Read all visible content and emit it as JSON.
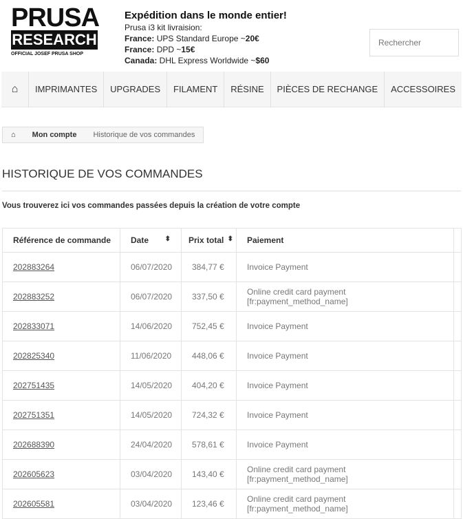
{
  "logo": {
    "line1": "PRUSA",
    "line2": "RESEARCH",
    "line3": "OFFICIAL JOSEF PRUSA SHOP"
  },
  "shipping": {
    "title": "Expédition dans le monde entier!",
    "subtitle": "Prusa i3 kit livraision:",
    "lines": [
      {
        "country": "France:",
        "carrier": " UPS Standard Europe ~",
        "price": "20€"
      },
      {
        "country": "France:",
        "carrier": " DPD ~",
        "price": "15€"
      },
      {
        "country": "Canada:",
        "carrier": " DHL Express Worldwide ~",
        "price": "$60"
      }
    ]
  },
  "search": {
    "placeholder": "Rechercher"
  },
  "nav": {
    "home_icon": "home-icon",
    "items": [
      "IMPRIMANTES",
      "UPGRADES",
      "FILAMENT",
      "RÉSINE",
      "PIÈCES DE RECHANGE",
      "ACCESSOIRES"
    ]
  },
  "breadcrumb": {
    "items": [
      "Mon compte",
      "Historique de vos commandes"
    ]
  },
  "page": {
    "title": "HISTORIQUE DE VOS COMMANDES",
    "intro": "Vous trouverez ici vos commandes passées depuis la création de votre compte"
  },
  "table": {
    "headers": [
      "Référence de commande",
      "Date",
      "Prix total",
      "Paiement"
    ],
    "rows": [
      [
        "202883264",
        "06/07/2020",
        "384,77 €",
        "Invoice Payment"
      ],
      [
        "202883252",
        "06/07/2020",
        "337,50 €",
        "Online credit card payment [fr:payment_method_name]"
      ],
      [
        "202833071",
        "14/06/2020",
        "752,45 €",
        "Invoice Payment"
      ],
      [
        "202825340",
        "11/06/2020",
        "448,06 €",
        "Invoice Payment"
      ],
      [
        "202751435",
        "14/05/2020",
        "404,20 €",
        "Invoice Payment"
      ],
      [
        "202751351",
        "14/05/2020",
        "724,32 €",
        "Invoice Payment"
      ],
      [
        "202688390",
        "24/04/2020",
        "578,61 €",
        "Invoice Payment"
      ],
      [
        "202605623",
        "03/04/2020",
        "143,40 €",
        "Online credit card payment [fr:payment_method_name]"
      ],
      [
        "202605581",
        "03/04/2020",
        "123,46 €",
        "Online credit card payment [fr:payment_method_name]"
      ]
    ]
  }
}
